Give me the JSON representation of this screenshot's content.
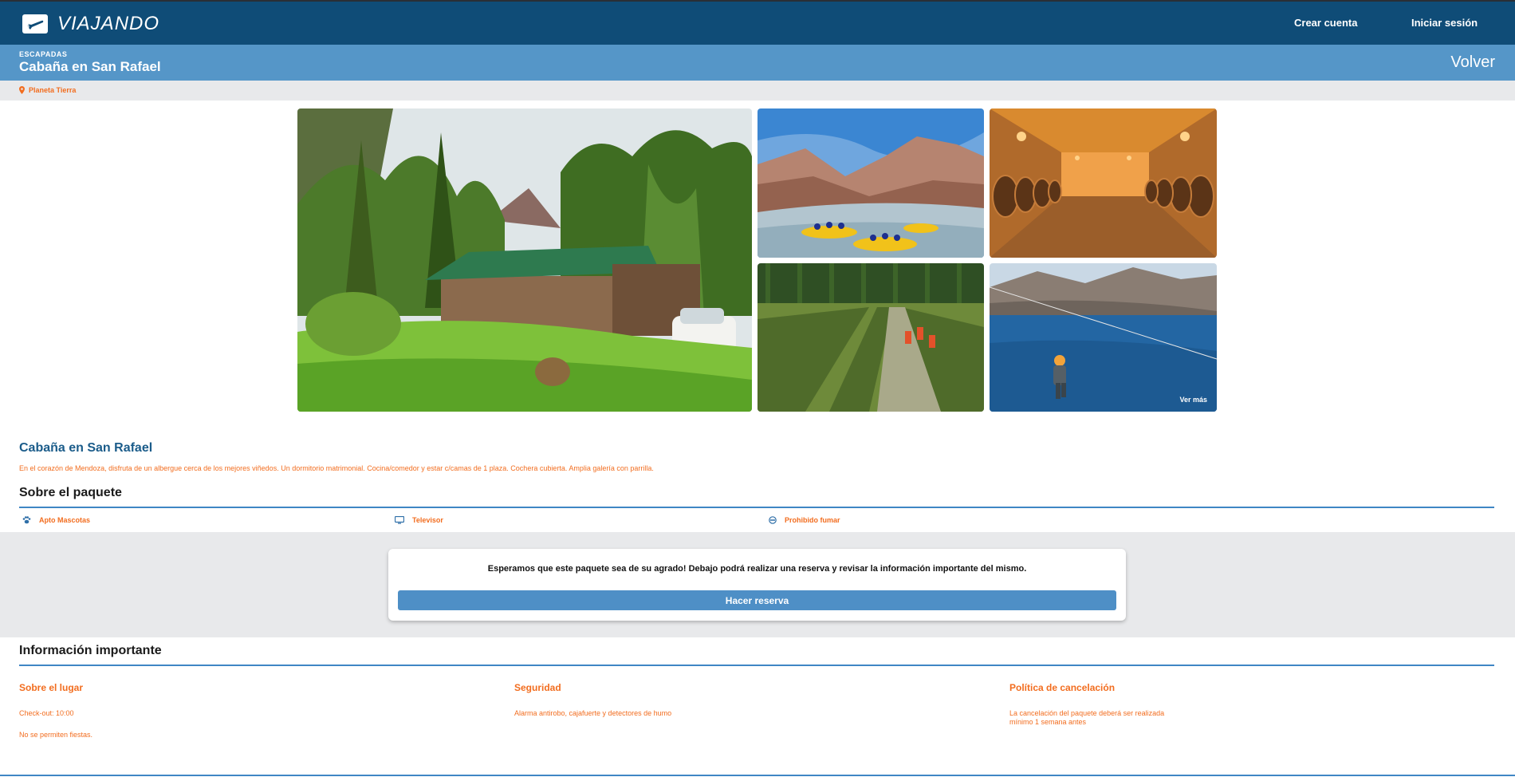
{
  "header": {
    "brand": "VIAJANDO",
    "nav": {
      "create_account": "Crear cuenta",
      "login": "Iniciar sesión"
    }
  },
  "subheader": {
    "category": "ESCAPADAS",
    "title": "Cabaña en San Rafael",
    "back_label": "Volver"
  },
  "location": {
    "text": "Planeta Tierra"
  },
  "gallery": {
    "see_more": "Ver más"
  },
  "product": {
    "title": "Cabaña en San Rafael",
    "description": "En el corazón de Mendoza, disfruta de un albergue cerca de los mejores viñedos. Un dormitorio matrimonial. Cocina/comedor y estar c/camas de 1 plaza. Cochera cubierta. Amplia galería con parrilla."
  },
  "about": {
    "title": "Sobre el paquete",
    "features": [
      {
        "label": "Apto Mascotas",
        "icon": "paw-icon"
      },
      {
        "label": "Televisor",
        "icon": "tv-icon"
      },
      {
        "label": "Prohibido fumar",
        "icon": "no-smoking-icon"
      }
    ]
  },
  "reservation": {
    "message": "Esperamos que este paquete sea de su agrado! Debajo podrá realizar una reserva y revisar la información importante del mismo.",
    "button_label": "Hacer reserva"
  },
  "important_info": {
    "title": "Información importante",
    "columns": [
      {
        "title": "Sobre el lugar",
        "items": [
          "Check-out: 10:00",
          "No se permiten fiestas."
        ]
      },
      {
        "title": "Seguridad",
        "items": [
          "Alarma antirobo, cajafuerte y detectores de humo"
        ]
      },
      {
        "title": "Política de cancelación",
        "items": [
          "La cancelación del paquete deberá ser realizada\nmínimo 1 semana antes"
        ]
      }
    ]
  },
  "colors": {
    "header": "#0f4c77",
    "subheader": "#5596c8",
    "accent_orange": "#f26d1f",
    "accent_blue": "#3f86c4"
  }
}
